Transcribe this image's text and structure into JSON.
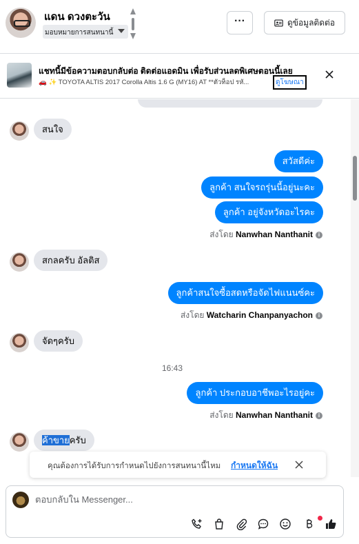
{
  "header": {
    "contact_name": "แดน ดวงตะวัน",
    "assign_label": "มอบหมายการสนทนานี้",
    "more_label": "···",
    "contact_info_label": "ดูข้อมูลติดต่อ"
  },
  "ad": {
    "title": "แชทนี้มีข้อความตอบกลับต่อ ติดต่อแอดมิน เพื่อรับส่วนลดพิเศษตอนนี้เลย",
    "subtitle": "TOYOTA ALTIS 2017 Corolla Altis 1.6 G (MY16) AT **ตัวท็อป รหั...",
    "emoji": "🚗 ✨",
    "link_label": "ดูโฆษณา"
  },
  "messages": {
    "in_1": "สนใจ",
    "out_1": "สวัสดีค่ะ",
    "out_2": "ลูกค้า  สนใจรถรุ่นนี้อยู่นะคะ",
    "out_3": "ลูกค้า  อยู่จังหวัดอะไรคะ",
    "sent_by_prefix": "ส่งโดย",
    "sender_1": "Nanwhan Nanthanit",
    "in_2": "สกลครับ    อัลติส",
    "out_4": "ลูกค้าสนใจซื้อสดหรือจัดไฟแนนซ์คะ",
    "sender_2": "Watcharin Chanpanyachon",
    "in_3": "จัดๆครับ",
    "time": "16:43",
    "out_5": "ลูกค้า ประกอบอาชีพอะไรอยู่คะ",
    "sender_3": "Nanwhan Nanthanit",
    "in_4_highlight": "ค้าขาย",
    "in_4_rest": "ครับ"
  },
  "assign_prompt": {
    "text": "คุณต้องการได้รับการกำหนดไปยังการสนทนานี้ไหม",
    "link": "กำหนดให้ฉัน"
  },
  "composer": {
    "placeholder": "ตอบกลับใน Messenger..."
  },
  "colors": {
    "accent": "#0084ff",
    "incoming": "#e4e6eb",
    "link": "#1877f2"
  }
}
